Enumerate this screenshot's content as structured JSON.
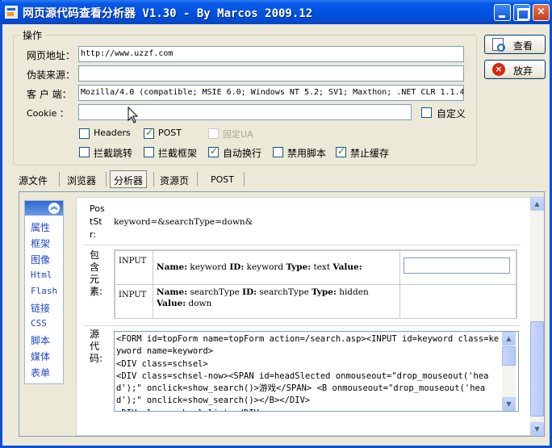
{
  "window": {
    "title": "网页源代码查看分析器 V1.30 - By Marcos 2009.12",
    "minimize": "",
    "maximize": "",
    "close": "×"
  },
  "options": {
    "group_label": "操作",
    "url_label": "网页地址：",
    "url_value": "http://www.uzzf.com",
    "referer_label": "伪装来源：",
    "referer_value": "",
    "client_label": "客 户 端：",
    "client_value": "Mozilla/4.0 (compatible; MSIE 6.0; Windows NT 5.2; SV1; Maxthon; .NET CLR 1.1.4",
    "cookie_label": "Cookie  ：",
    "cookie_value": "",
    "custom_label": "自定义",
    "headers_label": "Headers",
    "post_label": "POST",
    "fixed_ua_label": "固定UA",
    "block_redirect_label": "拦截跳转",
    "block_frame_label": "拦截框架",
    "auto_wrap_label": "自动换行",
    "disable_script_label": "禁用脚本",
    "disable_cache_label": "禁止缓存"
  },
  "buttons": {
    "view_label": "查看",
    "cancel_label": "放弃"
  },
  "tabs": [
    "源文件",
    "浏览器",
    "分析器",
    "资源页",
    "POST"
  ],
  "sidebar": {
    "toggle": "︽",
    "items": [
      "属性",
      "框架",
      "图像",
      "Html",
      "Flash",
      "链接",
      "CSS",
      "脚本",
      "媒体",
      "表单"
    ]
  },
  "form_detail": {
    "poststr_label": "PostStr:",
    "poststr_value": "keyword=&searchType=down&",
    "elements_label": "包含元素:",
    "elements": [
      {
        "type": "INPUT",
        "name_key": "Name:",
        "name": "keyword",
        "id_key": "ID:",
        "id": "keyword",
        "type_key": "Type:",
        "itype": "text",
        "value_key": "Value:",
        "value": ""
      },
      {
        "type": "INPUT",
        "name_key": "Name:",
        "name": "searchType",
        "id_key": "ID:",
        "id": "searchType",
        "type_key": "Type:",
        "itype": "hidden",
        "value_key": "Value:",
        "value": "down"
      }
    ],
    "source_label": "源代码:",
    "source_code": "<FORM id=topForm name=topForm action=/search.asp><INPUT id=keyword class=keyword name=keyword>\n<DIV class=schsel>\n<DIV class=schsel-now><SPAN id=headSlected onmouseout=\"drop_mouseout('head');\" onclick=show_search()>游戏</SPAN> <B onmouseout=\"drop_mouseout('head');\" onclick=show_search()></B></DIV>\n<DIV class=schsel-list></DIV>"
  }
}
